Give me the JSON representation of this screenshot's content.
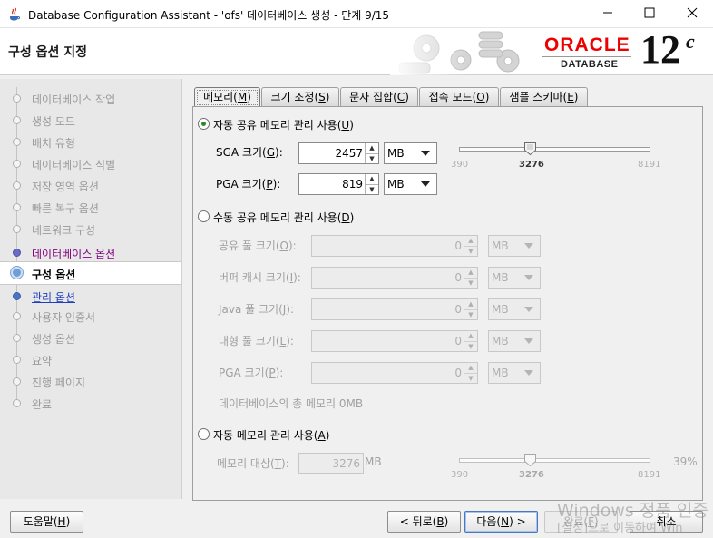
{
  "window": {
    "title": "Database Configuration Assistant - 'ofs' 데이터베이스 생성 - 단계 9/15"
  },
  "header": {
    "title": "구성 옵션 지정",
    "brand_oracle": "ORACLE",
    "brand_database": "DATABASE",
    "brand_version": "12",
    "brand_version_suffix": "c",
    "brand_color": "#e00000"
  },
  "steps": [
    {
      "label": "데이터베이스 작업",
      "state": "past"
    },
    {
      "label": "생성 모드",
      "state": "past"
    },
    {
      "label": "배치 유형",
      "state": "past"
    },
    {
      "label": "데이터베이스 식별",
      "state": "past"
    },
    {
      "label": "저장 영역 옵션",
      "state": "past"
    },
    {
      "label": "빠른 복구 옵션",
      "state": "past"
    },
    {
      "label": "네트워크 구성",
      "state": "past"
    },
    {
      "label": "데이터베이스 옵션",
      "state": "link"
    },
    {
      "label": "구성 옵션",
      "state": "current"
    },
    {
      "label": "관리 옵션",
      "state": "next"
    },
    {
      "label": "사용자 인증서",
      "state": "future"
    },
    {
      "label": "생성 옵션",
      "state": "future"
    },
    {
      "label": "요약",
      "state": "future"
    },
    {
      "label": "진행 페이지",
      "state": "future"
    },
    {
      "label": "완료",
      "state": "future"
    }
  ],
  "tabs": [
    {
      "label": "메모리(M)",
      "mnemonic_text": "메모리(",
      "mnemonic": "M",
      "suffix": ")"
    },
    {
      "label": "크기 조정(S)",
      "mnemonic_text": "크기 조정(",
      "mnemonic": "S",
      "suffix": ")"
    },
    {
      "label": "문자 집합(C)",
      "mnemonic_text": "문자 집합(",
      "mnemonic": "C",
      "suffix": ")"
    },
    {
      "label": "접속 모드(O)",
      "mnemonic_text": "접속 모드(",
      "mnemonic": "O",
      "suffix": ")"
    },
    {
      "label": "샘플 스키마(E)",
      "mnemonic_text": "샘플 스키마(",
      "mnemonic": "E",
      "suffix": ")"
    }
  ],
  "memory": {
    "auto_shared": {
      "pre": "자동 공유 메모리 관리 사용(",
      "key": "U",
      "post": ")",
      "selected": true
    },
    "sga": {
      "pre": "SGA 크기(",
      "key": "G",
      "post": "):",
      "value": "2457",
      "unit": "MB"
    },
    "pga": {
      "pre": "PGA 크기(",
      "key": "P",
      "post": "):",
      "value": "819",
      "unit": "MB"
    },
    "slider1": {
      "min": "390",
      "max": "8191",
      "value": "3276",
      "value_num": 3276,
      "min_num": 390,
      "max_num": 8191
    },
    "manual_shared": {
      "pre": "수동 공유 메모리 관리 사용(",
      "key": "D",
      "post": ")",
      "selected": false
    },
    "manual_fields": [
      {
        "pre": "공유 풀 크기(",
        "key": "O",
        "post": "):",
        "value": "0",
        "unit": "MB"
      },
      {
        "pre": "버퍼 캐시 크기(",
        "key": "I",
        "post": "):",
        "value": "0",
        "unit": "MB"
      },
      {
        "pre": "Java 풀 크기(",
        "key": "J",
        "post": "):",
        "value": "0",
        "unit": "MB"
      },
      {
        "pre": "대형 풀 크기(",
        "key": "L",
        "post": "):",
        "value": "0",
        "unit": "MB"
      },
      {
        "pre": "PGA 크기(",
        "key": "P",
        "post": "):",
        "value": "0",
        "unit": "MB"
      }
    ],
    "total_memory": "데이터베이스의 총 메모리 0MB",
    "auto_memory": {
      "pre": "자동 메모리 관리 사용(",
      "key": "A",
      "post": ")",
      "selected": false
    },
    "target": {
      "pre": "메모리 대상(",
      "key": "T",
      "post": "):",
      "value": "3276",
      "unit": "MB"
    },
    "slider2": {
      "min": "390",
      "max": "8191",
      "value": "3276",
      "percent": "39%",
      "value_num": 3276,
      "min_num": 390,
      "max_num": 8191
    }
  },
  "buttons": {
    "help": {
      "pre": "도움말(",
      "key": "H",
      "post": ")"
    },
    "back": {
      "pre": "< 뒤로(",
      "key": "B",
      "post": ")"
    },
    "next": {
      "pre": "다음(",
      "key": "N",
      "post": ") >"
    },
    "finish": {
      "pre": "완료(",
      "key": "F",
      "post": ")"
    },
    "cancel": "취소"
  },
  "watermark": {
    "line1": "Windows 정품 인증",
    "line2": "[설정]으로 이동하여 Win"
  }
}
